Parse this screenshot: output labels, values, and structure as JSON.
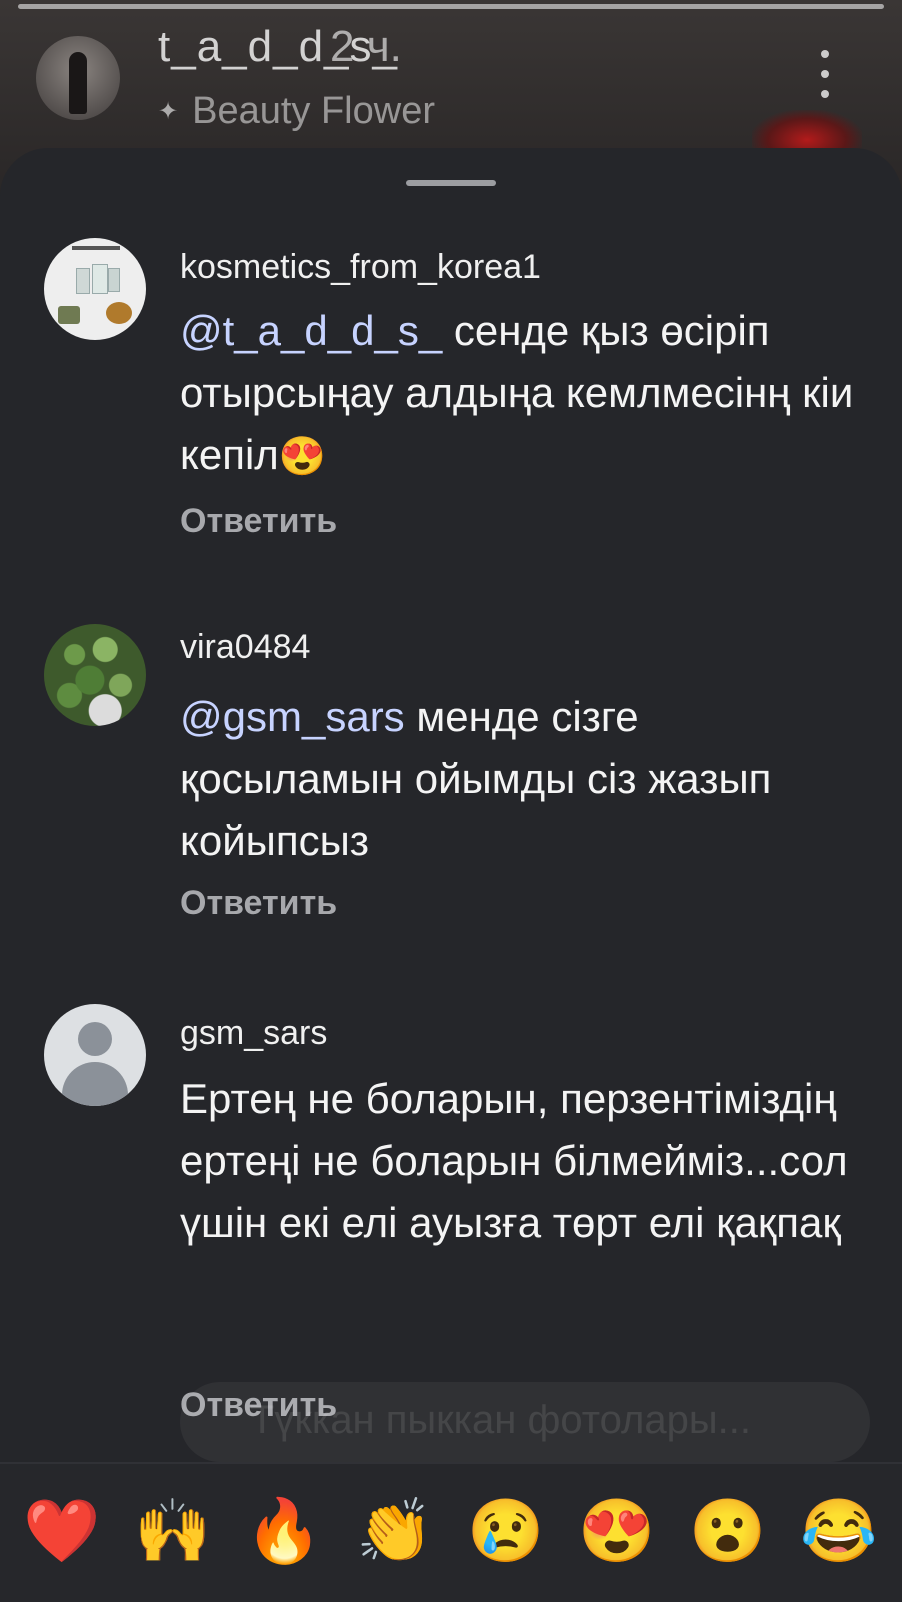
{
  "story": {
    "username": "t_a_d_d_s_",
    "time": "2 ч.",
    "music": "Beauty Flower"
  },
  "comments": [
    {
      "username": "kosmetics_from_korea1",
      "mention": "@t_a_d_d_s_",
      "text": "сенде қыз өсіріп отырсыңау алдыңа кемлмесінң кіи кепіл",
      "emoji": "😍",
      "reply": "Ответить"
    },
    {
      "username": "vira0484",
      "mention": "@gsm_sars",
      "text": "менде сізге қосыламын ойымды сіз жазып койыпсыз",
      "reply": "Ответить"
    },
    {
      "username": "gsm_sars",
      "text": "Ертең не боларын, перзентіміздің ертеңі не боларын білмейміз...сол үшін екі елі ауызға төрт елі қақпақ",
      "reply": "Ответить"
    }
  ],
  "ghost_input": "Tүккан пыккан фотолары...",
  "reactions": [
    "❤️",
    "🙌",
    "🔥",
    "👏",
    "😢",
    "😍",
    "😮",
    "😂"
  ]
}
